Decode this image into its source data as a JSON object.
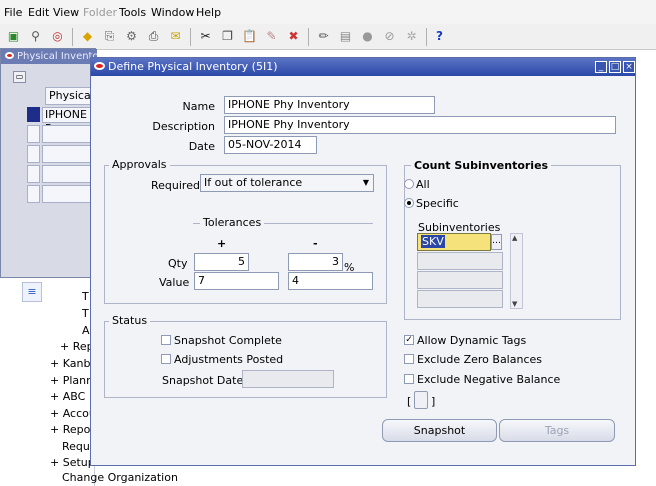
{
  "menu": {
    "file": "File",
    "edit": "Edit",
    "view": "View",
    "folder": "Folder",
    "tools": "Tools",
    "window": "Window",
    "help": "Help"
  },
  "background_window": {
    "title": "Physical Inventory Summary (5I1)",
    "col_header": "Physical",
    "row1": "IPHONE P"
  },
  "navigator": {
    "items": [
      "T",
      "T",
      "A",
      "+ Rep",
      "+ Kanba",
      "+ Plann",
      "+ ABC",
      "+ Accou",
      "+ Repor",
      "Reque",
      "+ Setup",
      "Change Organization"
    ]
  },
  "dialog": {
    "title": "Define Physical Inventory (5I1)",
    "name_label": "Name",
    "name_value": "IPHONE Phy Inventory",
    "description_label": "Description",
    "description_value": "IPHONE Phy Inventory",
    "date_label": "Date",
    "date_value": "05-NOV-2014",
    "approvals": {
      "group_label": "Approvals",
      "required_label": "Required",
      "required_value": "If out of tolerance",
      "tolerances_label": "Tolerances",
      "plus": "+",
      "minus": "-",
      "qty_label": "Qty",
      "qty_plus": "5",
      "qty_minus": "3",
      "percent": "%",
      "value_label": "Value",
      "value_plus": "7",
      "value_minus": "4"
    },
    "count_subinv": {
      "title": "Count Subinventories",
      "all": "All",
      "specific": "Specific",
      "subinv_label": "Subinventories",
      "rows": [
        "SKV",
        "",
        "",
        ""
      ]
    },
    "status": {
      "group_label": "Status",
      "snapshot_complete": "Snapshot Complete",
      "adjustments_posted": "Adjustments Posted",
      "snapshot_date_label": "Snapshot Date",
      "snapshot_date_value": ""
    },
    "options": {
      "allow_dynamic_tags": "Allow Dynamic Tags",
      "exclude_zero": "Exclude Zero Balances",
      "exclude_negative": "Exclude Negative Balance",
      "bracket_open": "[",
      "bracket_close": "]"
    },
    "buttons": {
      "snapshot": "Snapshot",
      "tags": "Tags"
    }
  },
  "colors": {
    "title_bar": "#2b47a8",
    "field_border": "#8f9bb5",
    "selected_cell": "#f5e27a"
  }
}
